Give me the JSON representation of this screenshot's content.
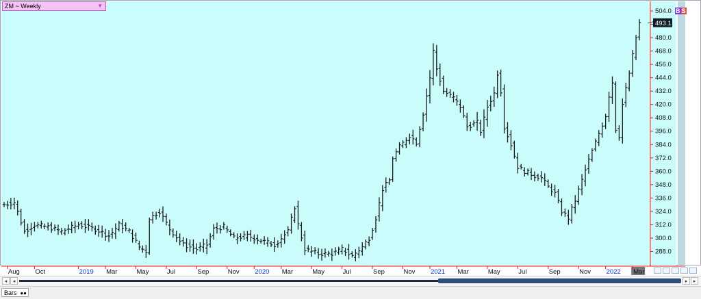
{
  "symbol_selector": {
    "label": "ZM ~ Weekly",
    "arrow": "▼"
  },
  "badges": {
    "b": "B",
    "s": "S"
  },
  "last_price_label": "493.1",
  "tabs": {
    "bars_label": "Bars",
    "bars_icon": "●●"
  },
  "scroll": {
    "left_double": "◂",
    "left": "◂",
    "right": "▸",
    "right_double": "▸"
  },
  "colors": {
    "plot_bg": "#cbfcfc",
    "axis_red": "#e01818",
    "bars": "#1a1a1a",
    "year_label": "#0033cc",
    "price_tag_bg": "#0d1e26",
    "price_scroll": "#bcd8e0"
  },
  "chart_data": {
    "type": "ohlc",
    "title": "ZM ~ Weekly",
    "y_ticks": [
      288.0,
      300.0,
      312.0,
      324.0,
      336.0,
      348.0,
      360.0,
      372.0,
      384.0,
      396.0,
      408.0,
      420.0,
      432.0,
      444.0,
      456.0,
      468.0,
      480.0,
      492.0,
      504.0
    ],
    "ylim": [
      276,
      512
    ],
    "last_price": 493.1,
    "x_labels": [
      {
        "text": "Aug",
        "week": 1,
        "year": false
      },
      {
        "text": "Oct",
        "week": 9,
        "year": false
      },
      {
        "text": "2019",
        "week": 22,
        "year": true
      },
      {
        "text": "Mar",
        "week": 30,
        "year": false
      },
      {
        "text": "May",
        "week": 39,
        "year": false
      },
      {
        "text": "Jul",
        "week": 48,
        "year": false
      },
      {
        "text": "Sep",
        "week": 57,
        "year": false
      },
      {
        "text": "Nov",
        "week": 66,
        "year": false
      },
      {
        "text": "2020",
        "week": 74,
        "year": true
      },
      {
        "text": "Mar",
        "week": 82,
        "year": false
      },
      {
        "text": "May",
        "week": 91,
        "year": false
      },
      {
        "text": "Jul",
        "week": 100,
        "year": false
      },
      {
        "text": "Sep",
        "week": 109,
        "year": false
      },
      {
        "text": "Nov",
        "week": 118,
        "year": false
      },
      {
        "text": "2021",
        "week": 126,
        "year": true
      },
      {
        "text": "Mar",
        "week": 134,
        "year": false
      },
      {
        "text": "May",
        "week": 143,
        "year": false
      },
      {
        "text": "Jul",
        "week": 152,
        "year": false
      },
      {
        "text": "Sep",
        "week": 161,
        "year": false
      },
      {
        "text": "Nov",
        "week": 170,
        "year": false
      },
      {
        "text": "2022",
        "week": 178,
        "year": true
      },
      {
        "text": "Mar",
        "week": 186,
        "year": false
      }
    ],
    "week_count": 189,
    "anchors": [
      [
        0,
        330
      ],
      [
        3,
        332
      ],
      [
        6,
        306
      ],
      [
        9,
        312
      ],
      [
        13,
        310
      ],
      [
        17,
        306
      ],
      [
        22,
        312
      ],
      [
        27,
        308
      ],
      [
        31,
        302
      ],
      [
        34,
        312
      ],
      [
        37,
        306
      ],
      [
        40,
        292
      ],
      [
        42,
        288
      ],
      [
        43,
        318
      ],
      [
        46,
        324
      ],
      [
        49,
        308
      ],
      [
        53,
        294
      ],
      [
        57,
        290
      ],
      [
        60,
        294
      ],
      [
        62,
        308
      ],
      [
        65,
        310
      ],
      [
        68,
        300
      ],
      [
        72,
        302
      ],
      [
        76,
        298
      ],
      [
        80,
        294
      ],
      [
        84,
        306
      ],
      [
        86,
        328
      ],
      [
        87,
        312
      ],
      [
        89,
        290
      ],
      [
        93,
        286
      ],
      [
        97,
        286
      ],
      [
        100,
        290
      ],
      [
        103,
        284
      ],
      [
        106,
        292
      ],
      [
        108,
        300
      ],
      [
        110,
        318
      ],
      [
        112,
        344
      ],
      [
        114,
        352
      ],
      [
        115,
        372
      ],
      [
        117,
        382
      ],
      [
        120,
        392
      ],
      [
        122,
        386
      ],
      [
        124,
        412
      ],
      [
        126,
        444
      ],
      [
        127,
        468
      ],
      [
        128,
        452
      ],
      [
        130,
        432
      ],
      [
        133,
        426
      ],
      [
        135,
        418
      ],
      [
        137,
        400
      ],
      [
        140,
        404
      ],
      [
        141,
        396
      ],
      [
        143,
        418
      ],
      [
        145,
        430
      ],
      [
        146,
        448
      ],
      [
        147,
        432
      ],
      [
        148,
        400
      ],
      [
        150,
        384
      ],
      [
        152,
        364
      ],
      [
        154,
        360
      ],
      [
        157,
        356
      ],
      [
        159,
        354
      ],
      [
        161,
        346
      ],
      [
        163,
        340
      ],
      [
        165,
        324
      ],
      [
        167,
        318
      ],
      [
        169,
        334
      ],
      [
        171,
        352
      ],
      [
        173,
        370
      ],
      [
        175,
        386
      ],
      [
        177,
        402
      ],
      [
        178,
        410
      ],
      [
        179,
        428
      ],
      [
        180,
        440
      ],
      [
        181,
        398
      ],
      [
        182,
        392
      ],
      [
        183,
        420
      ],
      [
        185,
        448
      ],
      [
        186,
        464
      ],
      [
        187,
        480
      ],
      [
        188,
        493.1
      ]
    ]
  }
}
